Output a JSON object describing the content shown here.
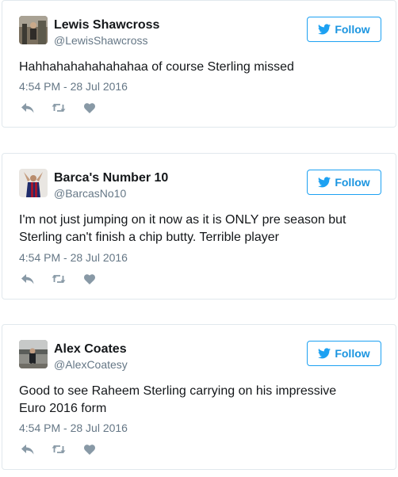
{
  "follow_label": "Follow",
  "colors": {
    "accent": "#1da1f2",
    "follow_text": "#1b95e0",
    "muted": "#657786",
    "border": "#e1e8ed",
    "icon": "#8899a6"
  },
  "icons": {
    "follow": "twitter-bird-icon",
    "reply": "reply-icon",
    "retweet": "retweet-icon",
    "like": "heart-icon"
  },
  "tweets": [
    {
      "name": "Lewis Shawcross",
      "handle": "@LewisShawcross",
      "text": "Hahhahahahahahahaa of course Sterling missed",
      "timestamp": "4:54 PM - 28 Jul 2016"
    },
    {
      "name": "Barca's Number 10",
      "handle": "@BarcasNo10",
      "text": "I'm not just jumping on it now as it is ONLY pre season but Sterling can't finish a chip butty. Terrible player",
      "timestamp": "4:54 PM - 28 Jul 2016"
    },
    {
      "name": "Alex Coates",
      "handle": "@AlexCoatesy",
      "text": "Good to see Raheem Sterling carrying on his impressive Euro 2016 form",
      "timestamp": "4:54 PM - 28 Jul 2016"
    }
  ]
}
